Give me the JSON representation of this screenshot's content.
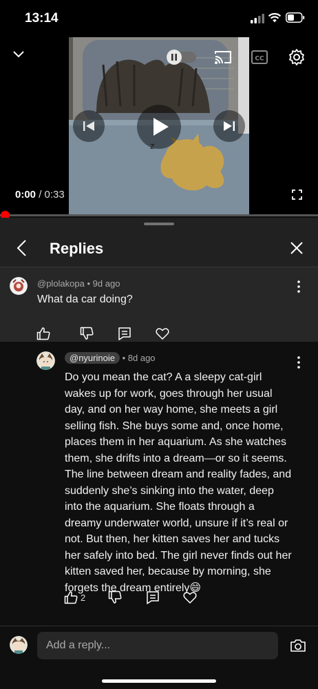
{
  "status_bar": {
    "time": "13:14"
  },
  "player": {
    "current_time": "0:00",
    "separator": " / ",
    "duration": "0:33",
    "progress_fraction": 0.0,
    "accent_color": "#ff0000",
    "icons": [
      "chevron-down-icon",
      "pause-icon",
      "cast-icon",
      "captions-icon",
      "settings-icon",
      "previous-icon",
      "play-icon",
      "next-icon",
      "fullscreen-icon"
    ]
  },
  "replies_panel": {
    "title": "Replies",
    "parent_comment": {
      "author": "@plolakopa",
      "age": "9d ago",
      "dot": "•",
      "text": "What da car doing?"
    },
    "reply": {
      "author": "@nyurinoie",
      "age": "8d ago",
      "dot": "•",
      "lines": [
        "Do you mean the cat? A a sleepy cat-girl",
        "wakes up for work, goes through her usual",
        "day, and on her way home, she meets a girl",
        "selling fish. She buys some and, once home,",
        "places them in her aquarium. As she watches",
        "them, she drifts into a dream—or so it seems.",
        "The line between dream and reality fades, and",
        "suddenly she’s sinking into the water, deep",
        "into the aquarium. She floats through a",
        "dreamy underwater world, unsure if it’s real or",
        "not. But then, her kitten saves her and tucks",
        "her safely into bed. The girl never finds out her",
        "kitten saved her, because by morning, she",
        "forgets the dream entirely😄"
      ],
      "like_count": "2"
    },
    "composer": {
      "placeholder": "Add a reply..."
    }
  }
}
